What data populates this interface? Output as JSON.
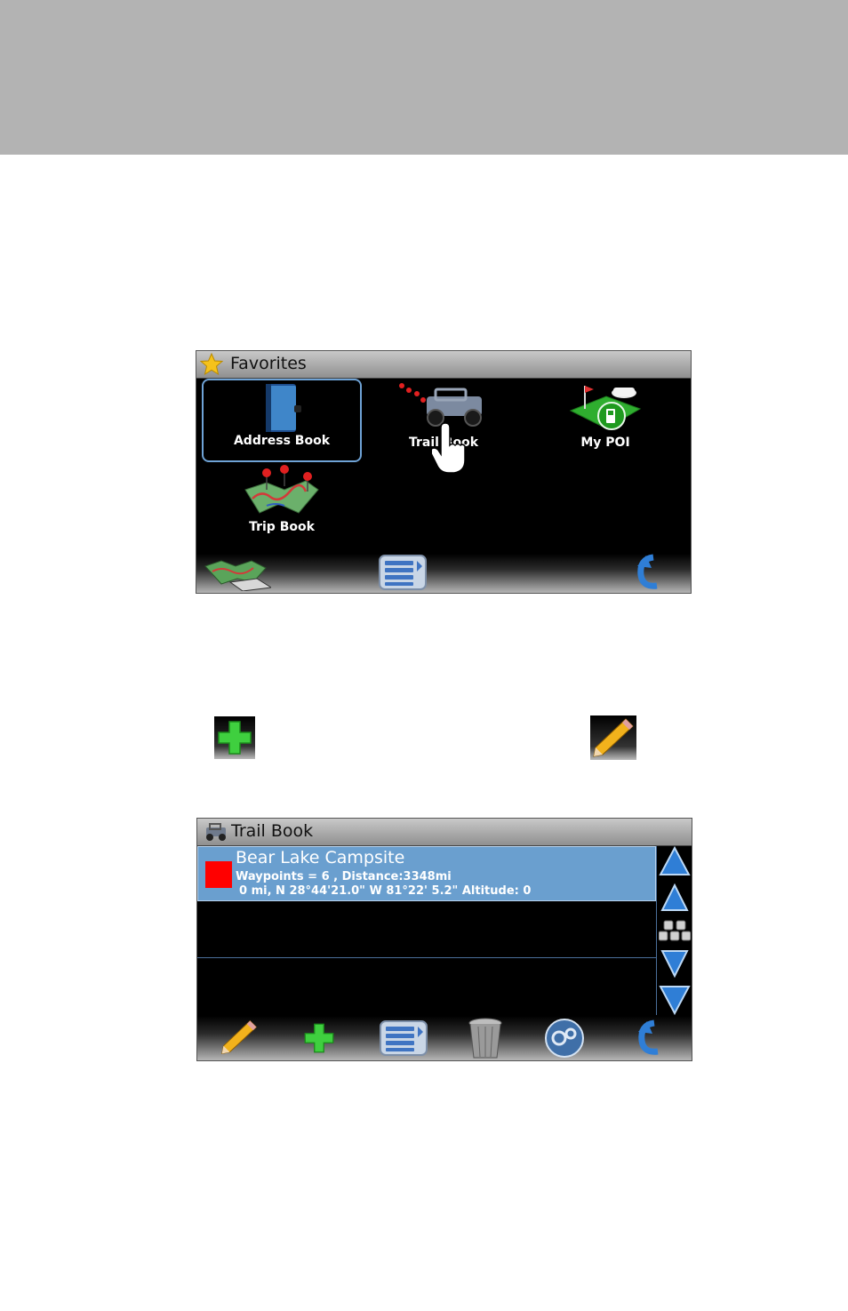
{
  "favorites": {
    "title": "Favorites",
    "tiles": [
      {
        "label": "Address Book",
        "icon": "address-book-icon",
        "selected": true
      },
      {
        "label": "Trail Book",
        "icon": "jeep-icon"
      },
      {
        "label": "My POI",
        "icon": "poi-icon"
      },
      {
        "label": "Trip Book",
        "icon": "trip-map-icon"
      }
    ],
    "toolbar": [
      "map-icon",
      "list-menu-icon",
      "back-arrow-icon"
    ]
  },
  "legend_icons": [
    "add-plus-icon",
    "edit-pencil-icon"
  ],
  "trail_book": {
    "title": "Trail Book",
    "entries": [
      {
        "name": "Bear Lake Campsite",
        "color": "#ff0000",
        "line1": "Waypoints = 6  , Distance:3348mi",
        "line2": "0 mi, N 28°44'21.0\"  W 81°22' 5.2\" Altitude: 0"
      }
    ],
    "scroll_buttons": [
      "page-up-icon",
      "line-up-icon",
      "keyboard-icon",
      "line-down-icon",
      "page-down-icon"
    ],
    "toolbar": [
      "edit-pencil-icon",
      "add-plus-icon",
      "list-menu-icon",
      "trash-icon",
      "settings-gears-icon",
      "back-arrow-icon"
    ]
  },
  "colors": {
    "banner": "#b3b3b3",
    "screen_bg": "#000000",
    "selection_blue": "#6a9fcf"
  }
}
